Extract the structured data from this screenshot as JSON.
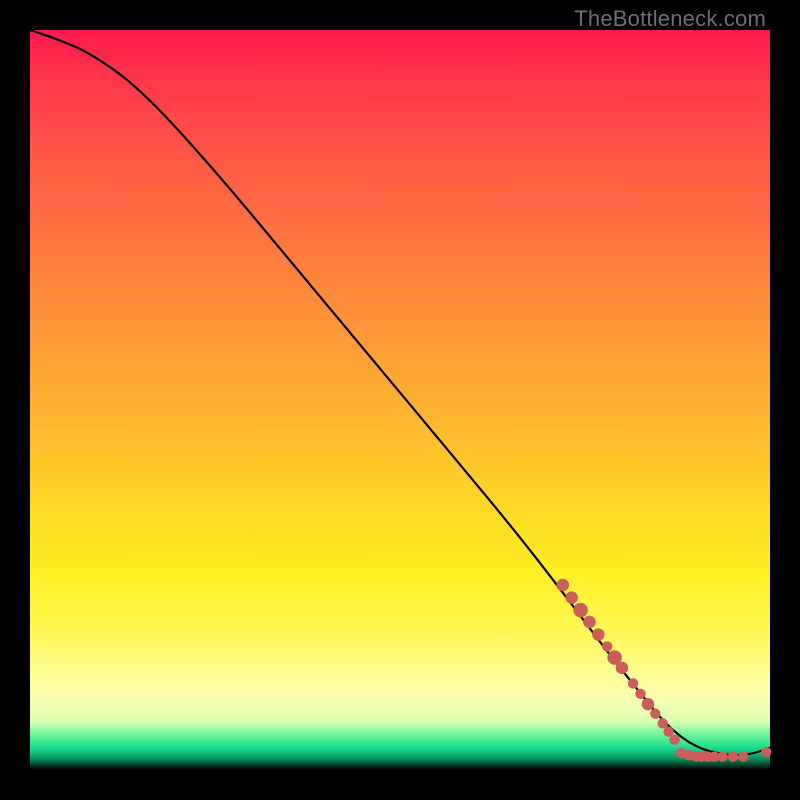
{
  "watermark": "TheBottleneck.com",
  "colors": {
    "page_bg": "#000000",
    "curve": "#000000",
    "dot": "#cd5c5c",
    "watermark": "#6f6f6f"
  },
  "chart_data": {
    "type": "line",
    "title": "",
    "xlabel": "",
    "ylabel": "",
    "xlim": [
      0,
      100
    ],
    "ylim": [
      0,
      100
    ],
    "grid": false,
    "legend": false,
    "series": [
      {
        "name": "curve",
        "x": [
          0,
          3,
          8,
          15,
          25,
          35,
          45,
          55,
          65,
          72,
          78,
          82,
          86,
          90,
          94,
          97,
          100
        ],
        "y": [
          100,
          99,
          97,
          92,
          81,
          69,
          57,
          45,
          33,
          24,
          16,
          11,
          6,
          3,
          2,
          2,
          3
        ]
      }
    ],
    "markers": [
      {
        "x": 72.0,
        "y": 25.0,
        "r": 1.2
      },
      {
        "x": 73.2,
        "y": 23.3,
        "r": 1.2
      },
      {
        "x": 74.4,
        "y": 21.6,
        "r": 1.4
      },
      {
        "x": 75.6,
        "y": 20.0,
        "r": 1.2
      },
      {
        "x": 76.8,
        "y": 18.3,
        "r": 1.2
      },
      {
        "x": 78.0,
        "y": 16.7,
        "r": 1.0
      },
      {
        "x": 79.0,
        "y": 15.2,
        "r": 1.4
      },
      {
        "x": 80.0,
        "y": 13.8,
        "r": 1.2
      },
      {
        "x": 81.5,
        "y": 11.7,
        "r": 1.0
      },
      {
        "x": 82.5,
        "y": 10.3,
        "r": 1.0
      },
      {
        "x": 83.5,
        "y": 8.9,
        "r": 1.2
      },
      {
        "x": 84.5,
        "y": 7.6,
        "r": 1.0
      },
      {
        "x": 85.5,
        "y": 6.3,
        "r": 1.0
      },
      {
        "x": 86.3,
        "y": 5.2,
        "r": 1.0
      },
      {
        "x": 87.1,
        "y": 4.1,
        "r": 1.0
      },
      {
        "x": 88.0,
        "y": 2.3,
        "r": 1.0
      },
      {
        "x": 89.0,
        "y": 2.0,
        "r": 1.0
      },
      {
        "x": 90.0,
        "y": 1.8,
        "r": 1.0
      },
      {
        "x": 90.8,
        "y": 1.8,
        "r": 1.0
      },
      {
        "x": 91.6,
        "y": 1.8,
        "r": 1.0
      },
      {
        "x": 92.5,
        "y": 1.8,
        "r": 1.0
      },
      {
        "x": 93.6,
        "y": 1.8,
        "r": 1.0
      },
      {
        "x": 95.0,
        "y": 1.8,
        "r": 1.0
      },
      {
        "x": 96.4,
        "y": 1.8,
        "r": 1.0
      },
      {
        "x": 99.5,
        "y": 2.4,
        "r": 1.0
      }
    ]
  }
}
